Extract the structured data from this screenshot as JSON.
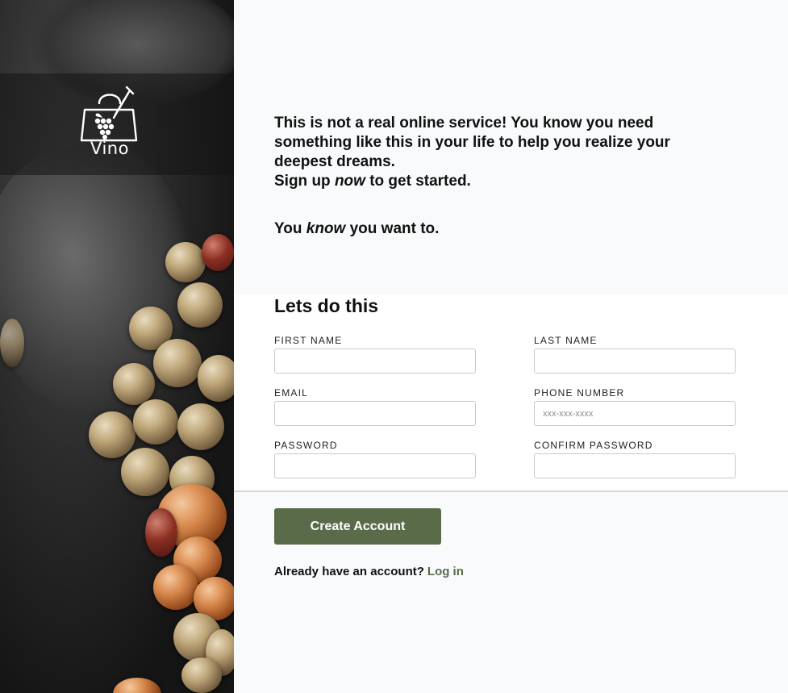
{
  "brand": {
    "name": "Vino"
  },
  "intro": {
    "line1": "This is not a real online service! You know you need something like this in your life to help you realize your deepest dreams.",
    "signup_pre": "Sign up ",
    "signup_em": "now",
    "signup_post": " to get started.",
    "tag_pre": "You ",
    "tag_em": "know",
    "tag_post": " you want to."
  },
  "form": {
    "title": "Lets do this",
    "fields": {
      "first_name": {
        "label": "FIRST NAME",
        "value": "",
        "placeholder": ""
      },
      "last_name": {
        "label": "LAST NAME",
        "value": "",
        "placeholder": ""
      },
      "email": {
        "label": "EMAIL",
        "value": "",
        "placeholder": ""
      },
      "phone": {
        "label": "PHONE NUMBER",
        "value": "",
        "placeholder": "xxx-xxx-xxxx"
      },
      "password": {
        "label": "PASSWORD",
        "value": "",
        "placeholder": ""
      },
      "confirm_password": {
        "label": "CONFIRM PASSWORD",
        "value": "",
        "placeholder": ""
      }
    },
    "submit_label": "Create Account",
    "login_prompt": "Already have an account?",
    "login_link": "Log in"
  },
  "icons": {
    "logo": "wine-bag-icon"
  },
  "colors": {
    "accent": "#5a6b49",
    "page_bg": "#f9fafb",
    "panel_bg": "#ffffff"
  }
}
